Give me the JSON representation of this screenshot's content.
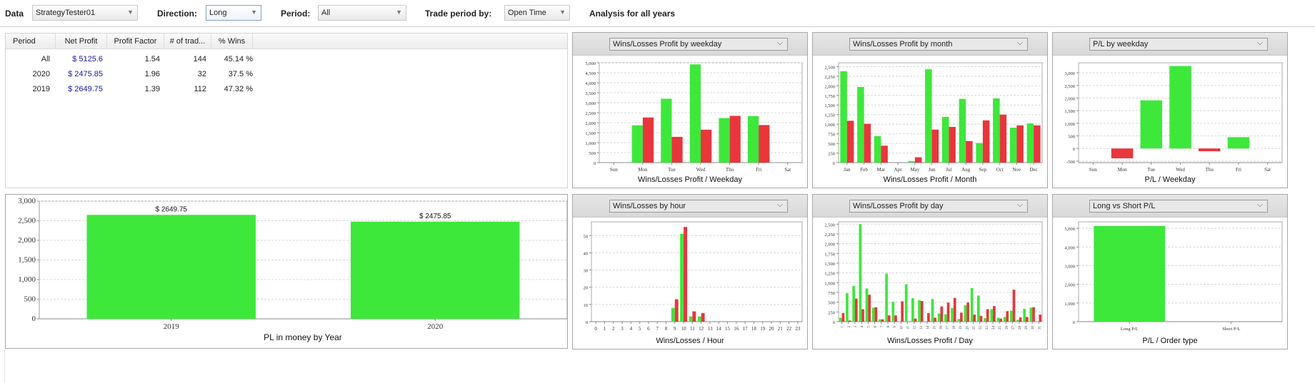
{
  "toolbar": {
    "data_label": "Data",
    "data_value": "StrategyTester01",
    "direction_label": "Direction:",
    "direction_value": "Long",
    "period_label": "Period:",
    "period_value": "All",
    "trade_period_label": "Trade period by:",
    "trade_period_value": "Open Time",
    "analysis_text": "Analysis for all years",
    "dropdown_icon": "triangle-down"
  },
  "stats_table": {
    "columns": [
      "Period",
      "Net Profit",
      "Profit Factor",
      "# of trad...",
      "% Wins"
    ],
    "rows": [
      [
        "All",
        "$ 5125.6",
        "1.54",
        "144",
        "45.14 %"
      ],
      [
        "2020",
        "$ 2475.85",
        "1.96",
        "32",
        "37.5 %"
      ],
      [
        "2019",
        "$ 2649.75",
        "1.39",
        "112",
        "47.32 %"
      ]
    ]
  },
  "colors": {
    "win": "#3de83b",
    "loss": "#e8363c",
    "money_text": "#1a1aa8"
  },
  "chart_data": [
    {
      "id": "year",
      "type": "bar",
      "title": "PL in money by Year",
      "categories": [
        "2019",
        "2020"
      ],
      "values": [
        2649.75,
        2475.85
      ],
      "data_labels": [
        "$ 2649.75",
        "$ 2475.85"
      ],
      "yticks": [
        "0",
        "500",
        "1,000",
        "1,500",
        "2,000",
        "2,500",
        "3,000"
      ],
      "ylim": [
        0,
        3000
      ],
      "grid": true
    },
    {
      "id": "weekday",
      "type": "bar",
      "selector": "Wins/Losses Profit by weekday",
      "title": "Wins/Losses Profit / Weekday",
      "categories": [
        "Sun",
        "Mon",
        "Tue",
        "Wed",
        "Thu",
        "Fri",
        "Sat"
      ],
      "series": [
        {
          "name": "Wins",
          "values": [
            0,
            1870,
            3200,
            4920,
            2230,
            2330,
            0
          ]
        },
        {
          "name": "Losses",
          "values": [
            0,
            2260,
            1290,
            1650,
            2340,
            1880,
            0
          ]
        }
      ],
      "yticks": [
        "0",
        "500",
        "1,000",
        "1,500",
        "2,000",
        "2,500",
        "3,000",
        "3,500",
        "4,000",
        "4,500",
        "5,000"
      ],
      "ylim": [
        0,
        5000
      ],
      "grid": true
    },
    {
      "id": "month",
      "type": "bar",
      "selector": "Wins/Losses Profit by month",
      "title": "Wins/Losses Profit / Month",
      "categories": [
        "Jan",
        "Feb",
        "Mar",
        "Apr",
        "May",
        "Jun",
        "Jul",
        "Aug",
        "Sep",
        "Oct",
        "Nov",
        "Dec"
      ],
      "series": [
        {
          "name": "Wins",
          "values": [
            2380,
            1970,
            690,
            0,
            40,
            2430,
            1190,
            1660,
            510,
            1670,
            910,
            1020
          ]
        },
        {
          "name": "Losses",
          "values": [
            1090,
            1010,
            440,
            0,
            140,
            860,
            930,
            560,
            1100,
            1250,
            970,
            970
          ]
        }
      ],
      "yticks": [
        "0",
        "250",
        "500",
        "750",
        "1,000",
        "1,250",
        "1,500",
        "1,750",
        "2,000",
        "2,250",
        "2,500"
      ],
      "ylim": [
        0,
        2600
      ],
      "grid": true
    },
    {
      "id": "pl-weekday",
      "type": "bar",
      "selector": "P/L by weekday",
      "title": "P/L / Weekday",
      "categories": [
        "Sun",
        "Mon",
        "Tue",
        "Wed",
        "Thu",
        "Fri",
        "Sat"
      ],
      "values": [
        0,
        -390,
        1910,
        3270,
        -110,
        450,
        0
      ],
      "yticks": [
        "-500",
        "0",
        "500",
        "1,000",
        "1,500",
        "2,000",
        "2,500",
        "3,000"
      ],
      "ylim": [
        -560,
        3400
      ],
      "grid": true
    },
    {
      "id": "hour",
      "type": "bar",
      "selector": "Wins/Losses by hour",
      "title": "Wins/Losses / Hour",
      "categories": [
        "0",
        "1",
        "2",
        "3",
        "4",
        "5",
        "6",
        "7",
        "8",
        "9",
        "10",
        "11",
        "12",
        "13",
        "14",
        "15",
        "16",
        "17",
        "18",
        "19",
        "20",
        "21",
        "22",
        "23"
      ],
      "series": [
        {
          "name": "Wins",
          "values": [
            0,
            0,
            0,
            0,
            0,
            0,
            0,
            0,
            0,
            8,
            51,
            3,
            3,
            0,
            0,
            0,
            0,
            0,
            0,
            0,
            0,
            0,
            0,
            0
          ]
        },
        {
          "name": "Losses",
          "values": [
            0,
            0,
            0,
            0,
            0,
            0,
            0,
            0,
            0,
            13,
            55,
            6,
            5,
            0,
            0,
            0,
            0,
            0,
            0,
            0,
            0,
            0,
            0,
            0
          ]
        }
      ],
      "yticks": [
        "0",
        "10",
        "20",
        "30",
        "40",
        "50"
      ],
      "ylim": [
        0,
        58
      ],
      "grid": true
    },
    {
      "id": "day",
      "type": "bar",
      "selector": "Wins/Losses Profit by day",
      "title": "Wins/Losses Profit / Day",
      "categories": [
        "1",
        "2",
        "3",
        "4",
        "5",
        "6",
        "7",
        "8",
        "9",
        "10",
        "11",
        "12",
        "13",
        "14",
        "15",
        "16",
        "17",
        "18",
        "19",
        "20",
        "21",
        "22",
        "23",
        "24",
        "25",
        "26",
        "27",
        "28",
        "29",
        "30",
        "31"
      ],
      "series": [
        {
          "name": "Wins",
          "values": [
            100,
            730,
            920,
            2500,
            850,
            360,
            60,
            1230,
            510,
            0,
            960,
            600,
            550,
            0,
            580,
            210,
            190,
            350,
            70,
            420,
            860,
            670,
            90,
            320,
            100,
            120,
            280,
            50,
            330,
            360,
            0
          ]
        },
        {
          "name": "Losses",
          "values": [
            220,
            30,
            590,
            320,
            690,
            370,
            60,
            160,
            160,
            520,
            0,
            80,
            530,
            220,
            100,
            390,
            490,
            610,
            230,
            490,
            180,
            150,
            320,
            400,
            80,
            270,
            820,
            110,
            120,
            370,
            180
          ]
        }
      ],
      "yticks": [
        "0",
        "250",
        "500",
        "750",
        "1,000",
        "1,250",
        "1,500",
        "1,750",
        "2,000",
        "2,250",
        "2,500"
      ],
      "ylim": [
        0,
        2560
      ],
      "grid": true
    },
    {
      "id": "long-short",
      "type": "bar",
      "selector": "Long vs Short P/L",
      "title": "P/L / Order type",
      "categories": [
        "Long P/L",
        "Short P/L"
      ],
      "values": [
        5125.6,
        0
      ],
      "yticks": [
        "0",
        "1,000",
        "2,000",
        "3,000",
        "4,000",
        "5,000"
      ],
      "ylim": [
        0,
        5350
      ],
      "grid": true
    }
  ]
}
